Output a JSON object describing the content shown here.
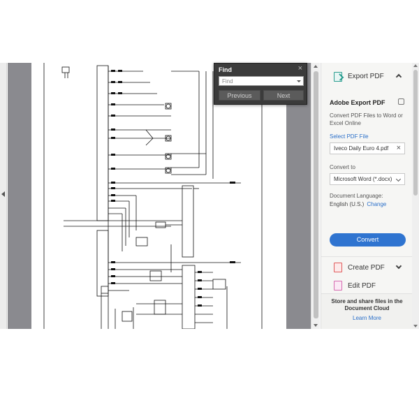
{
  "find": {
    "title": "Find",
    "placeholder": "Find",
    "previous_label": "Previous",
    "next_label": "Next"
  },
  "pane": {
    "header_label": "Export PDF",
    "section_title": "Adobe Export PDF",
    "description": "Convert PDF Files to Word or Excel Online",
    "select_file_link": "Select PDF File",
    "file_name": "Iveco Daily Euro 4.pdf",
    "convert_to_label": "Convert to",
    "convert_to_value": "Microsoft Word (*.docx)",
    "language_label": "Document Language:",
    "language_value": "English (U.S.)",
    "language_change": "Change",
    "convert_button": "Convert",
    "tools": [
      {
        "label": "Create PDF"
      },
      {
        "label": "Edit PDF"
      }
    ],
    "promo_text": "Store and share files in the Document Cloud",
    "promo_link": "Learn More"
  },
  "colors": {
    "accent": "#2f74d0",
    "link": "#2a6fc9",
    "export_icon": "#2a9d8f",
    "create_icon": "#e05a5a",
    "edit_icon": "#d66bb0"
  }
}
